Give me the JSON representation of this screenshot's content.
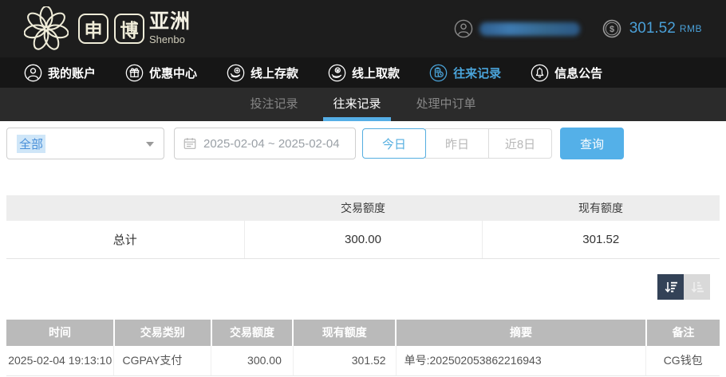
{
  "header": {
    "logo": {
      "char1": "申",
      "char2": "博",
      "region": "亚洲",
      "subtitle": "Shenbo"
    },
    "balance": {
      "amount": "301.52",
      "currency": "RMB"
    }
  },
  "nav": {
    "items": [
      {
        "label": "我的账户",
        "icon": "user-icon"
      },
      {
        "label": "优惠中心",
        "icon": "gift-icon"
      },
      {
        "label": "线上存款",
        "icon": "deposit-icon"
      },
      {
        "label": "线上取款",
        "icon": "withdraw-icon"
      },
      {
        "label": "往来记录",
        "icon": "records-icon"
      },
      {
        "label": "信息公告",
        "icon": "bell-icon"
      }
    ],
    "active_index": 4
  },
  "subnav": {
    "tabs": [
      "投注记录",
      "往来记录",
      "处理中订单"
    ],
    "active_index": 1
  },
  "filters": {
    "type_select": {
      "value": "全部"
    },
    "date_range": "2025-02-04 ~ 2025-02-04",
    "quick": [
      "今日",
      "昨日",
      "近8日"
    ],
    "active_quick_index": 0,
    "search_label": "查询"
  },
  "summary_table": {
    "columns": [
      "",
      "交易额度",
      "现有额度"
    ],
    "rows": [
      [
        "总计",
        "300.00",
        "301.52"
      ]
    ]
  },
  "transactions_table": {
    "columns": [
      "时间",
      "交易类别",
      "交易额度",
      "现有额度",
      "摘要",
      "备注"
    ],
    "rows": [
      [
        "2025-02-04 19:13:10",
        "CGPAY支付",
        "300.00",
        "301.52",
        "单号:202502053862216943",
        "CG钱包"
      ]
    ]
  },
  "icons": {
    "top": [
      "user-icon",
      "dollar-coin-icon"
    ],
    "nav": [
      "user-icon",
      "gift-icon",
      "deposit-icon",
      "withdraw-icon",
      "records-icon",
      "bell-icon"
    ],
    "filter": [
      "calendar-icon",
      "chevron-down-icon"
    ],
    "sort": [
      "sort-descending-icon",
      "sort-ascending-icon"
    ]
  },
  "colors": {
    "accent_blue": "#4aa4da",
    "button_blue": "#54b0e8",
    "tab_underline": "#55aee6",
    "logo_cream": "#efecd8",
    "topbar_bg": "#1d1d1d",
    "subnav_bg": "#2b2b2b",
    "table_header_gray": "#bababa",
    "sort_active_bg": "#334257"
  }
}
